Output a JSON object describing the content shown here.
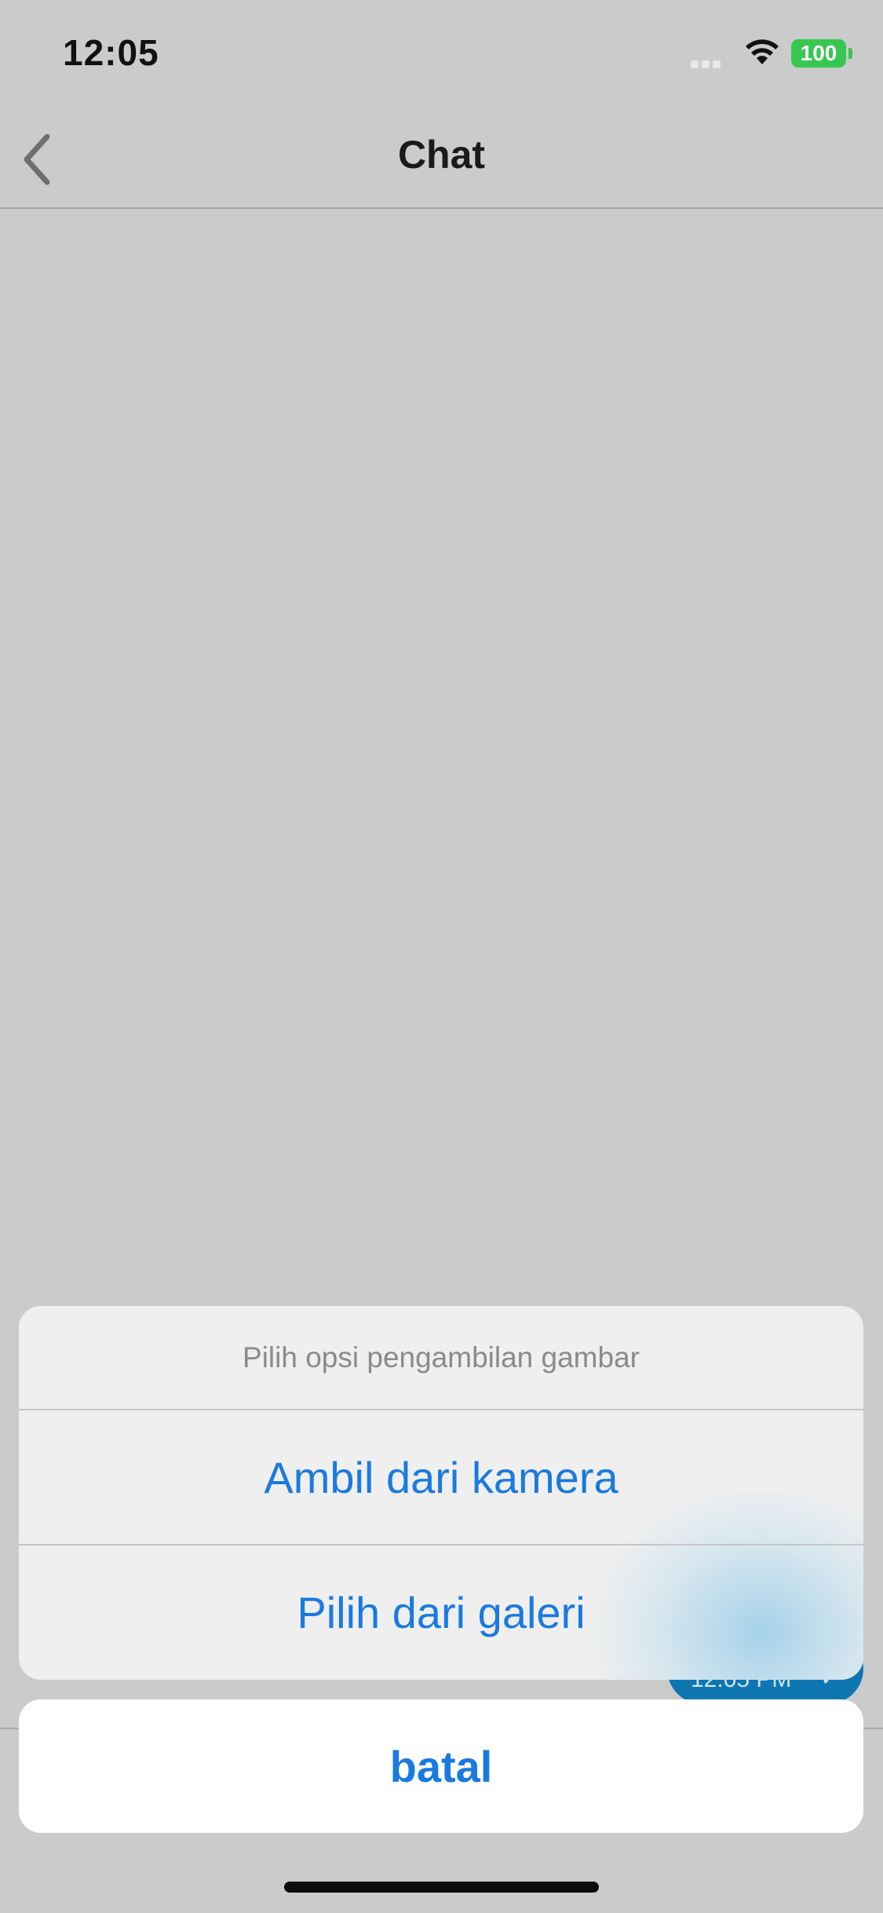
{
  "status_bar": {
    "time": "12:05",
    "battery": "100",
    "battery_color": "#37c650"
  },
  "nav": {
    "title": "Chat",
    "back_icon": "chevron-left-icon"
  },
  "background_chat": {
    "bubble_time": "12:05 PM",
    "bubble_check": "✓",
    "bubble_color": "#0d76b3"
  },
  "action_sheet": {
    "title": "Pilih opsi pengambilan gambar",
    "options": [
      {
        "label": "Ambil dari kamera"
      },
      {
        "label": "Pilih dari galeri"
      }
    ],
    "cancel_label": "batal",
    "accent_color": "#1a7ae0"
  }
}
